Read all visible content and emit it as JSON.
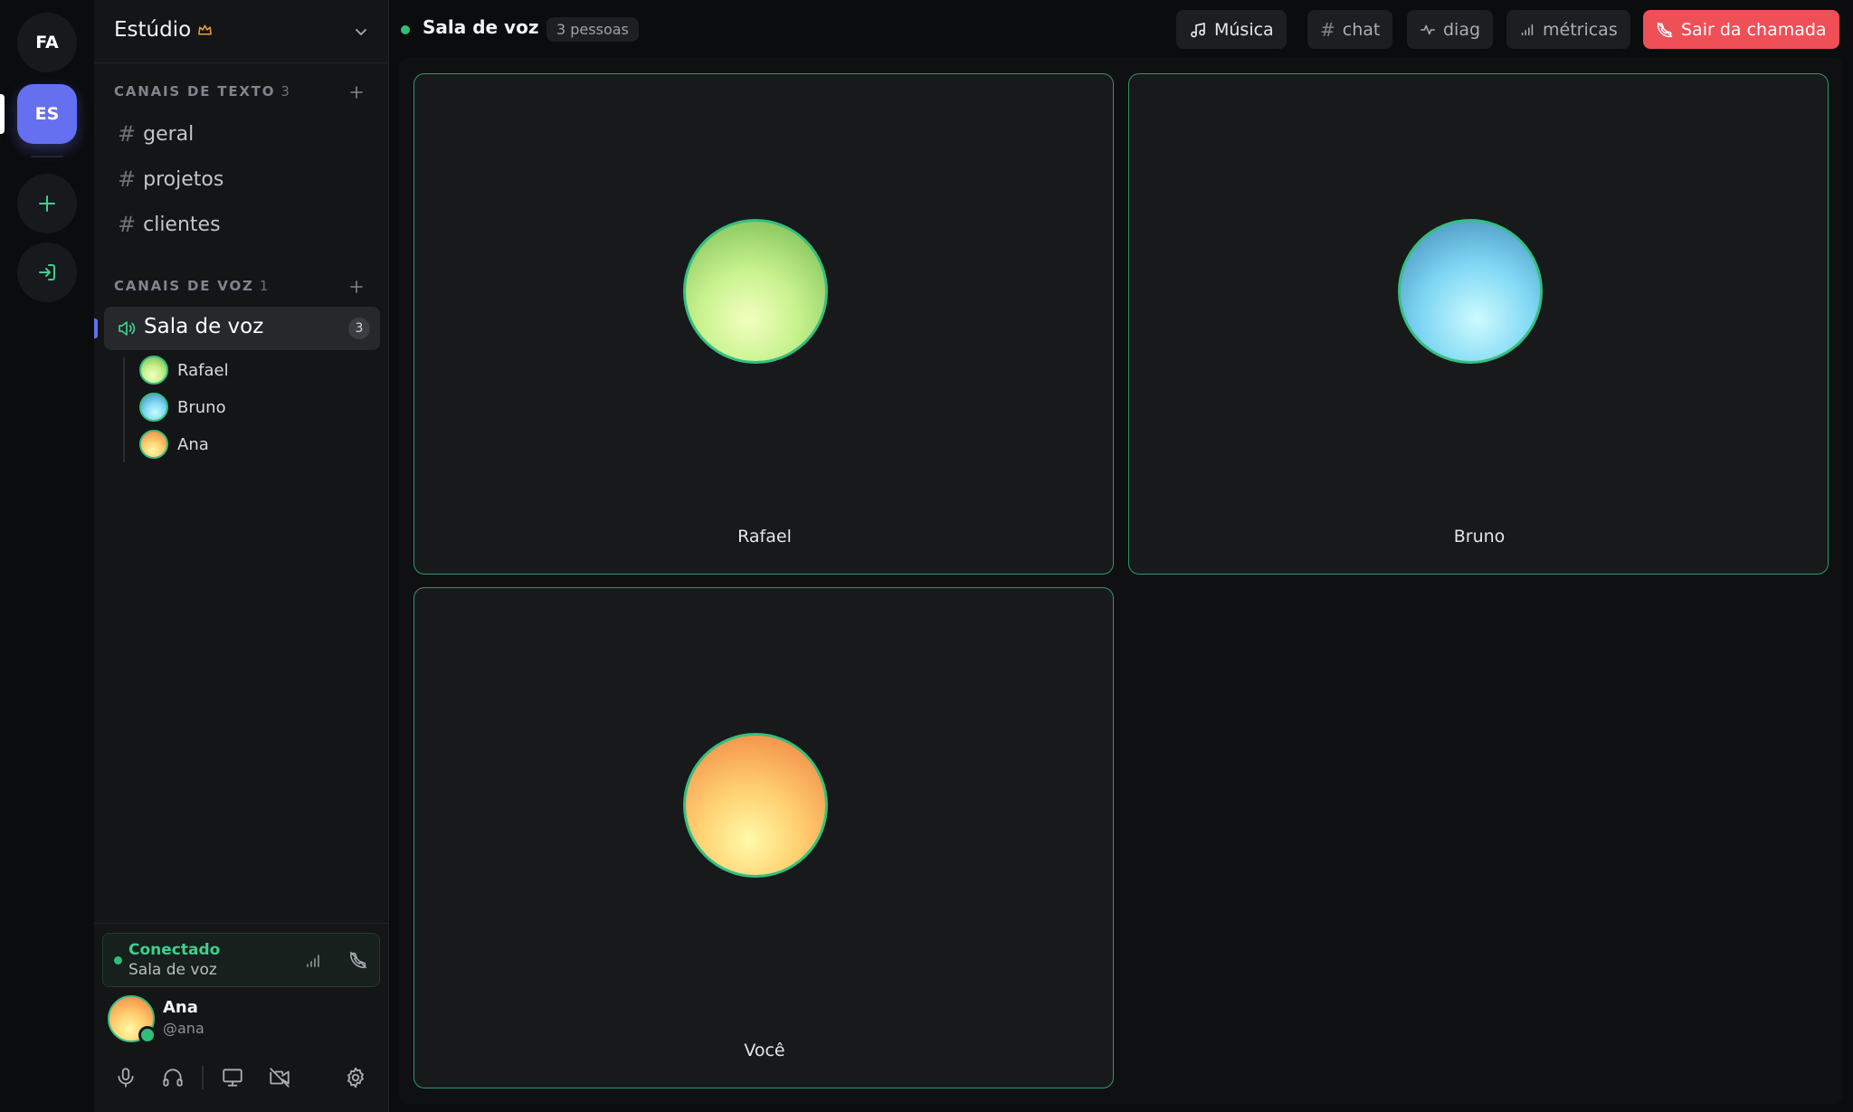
{
  "rail": {
    "servers": [
      {
        "abbr": "FA"
      },
      {
        "abbr": "ES",
        "active": true
      }
    ],
    "add_icon": "plus-icon",
    "join_icon": "login-icon"
  },
  "server": {
    "name": "Estúdio",
    "owner_icon": "crown-icon",
    "menu_icon": "chevron-down-icon"
  },
  "text_channels": {
    "header": "CANAIS DE TEXTO",
    "count": "3",
    "items": [
      {
        "name": "geral"
      },
      {
        "name": "projetos"
      },
      {
        "name": "clientes"
      }
    ]
  },
  "voice_channels": {
    "header": "CANAIS DE VOZ",
    "count": "1",
    "items": [
      {
        "name": "Sala de voz",
        "participants": "3",
        "members": [
          {
            "name": "Rafael",
            "avatar": "green-orb"
          },
          {
            "name": "Bruno",
            "avatar": "blue-orb"
          },
          {
            "name": "Ana",
            "avatar": "orange-orb"
          }
        ]
      }
    ]
  },
  "connection": {
    "status": "Conectado",
    "channel": "Sala de voz",
    "status_color": "#3ecf8e"
  },
  "user": {
    "name": "Ana",
    "handle": "@ana"
  },
  "controls": [
    "mic-icon",
    "headphones-icon",
    "screen-share-icon",
    "camera-off-icon",
    "settings-icon"
  ],
  "topbar": {
    "title": "Sala de voz",
    "people": "3 pessoas",
    "buttons": {
      "music": "Música",
      "chat": "chat",
      "diag": "diag",
      "metrics": "métricas",
      "leave": "Sair da chamada"
    },
    "leave_color": "#ef4f57"
  },
  "tiles": [
    {
      "name": "Rafael",
      "avatar": "green-orb"
    },
    {
      "name": "Bruno",
      "avatar": "blue-orb"
    },
    {
      "name": "Você",
      "avatar": "orange-orb"
    }
  ],
  "colors": {
    "accent": "#6470f0",
    "speaking_border": "#34c07f"
  }
}
